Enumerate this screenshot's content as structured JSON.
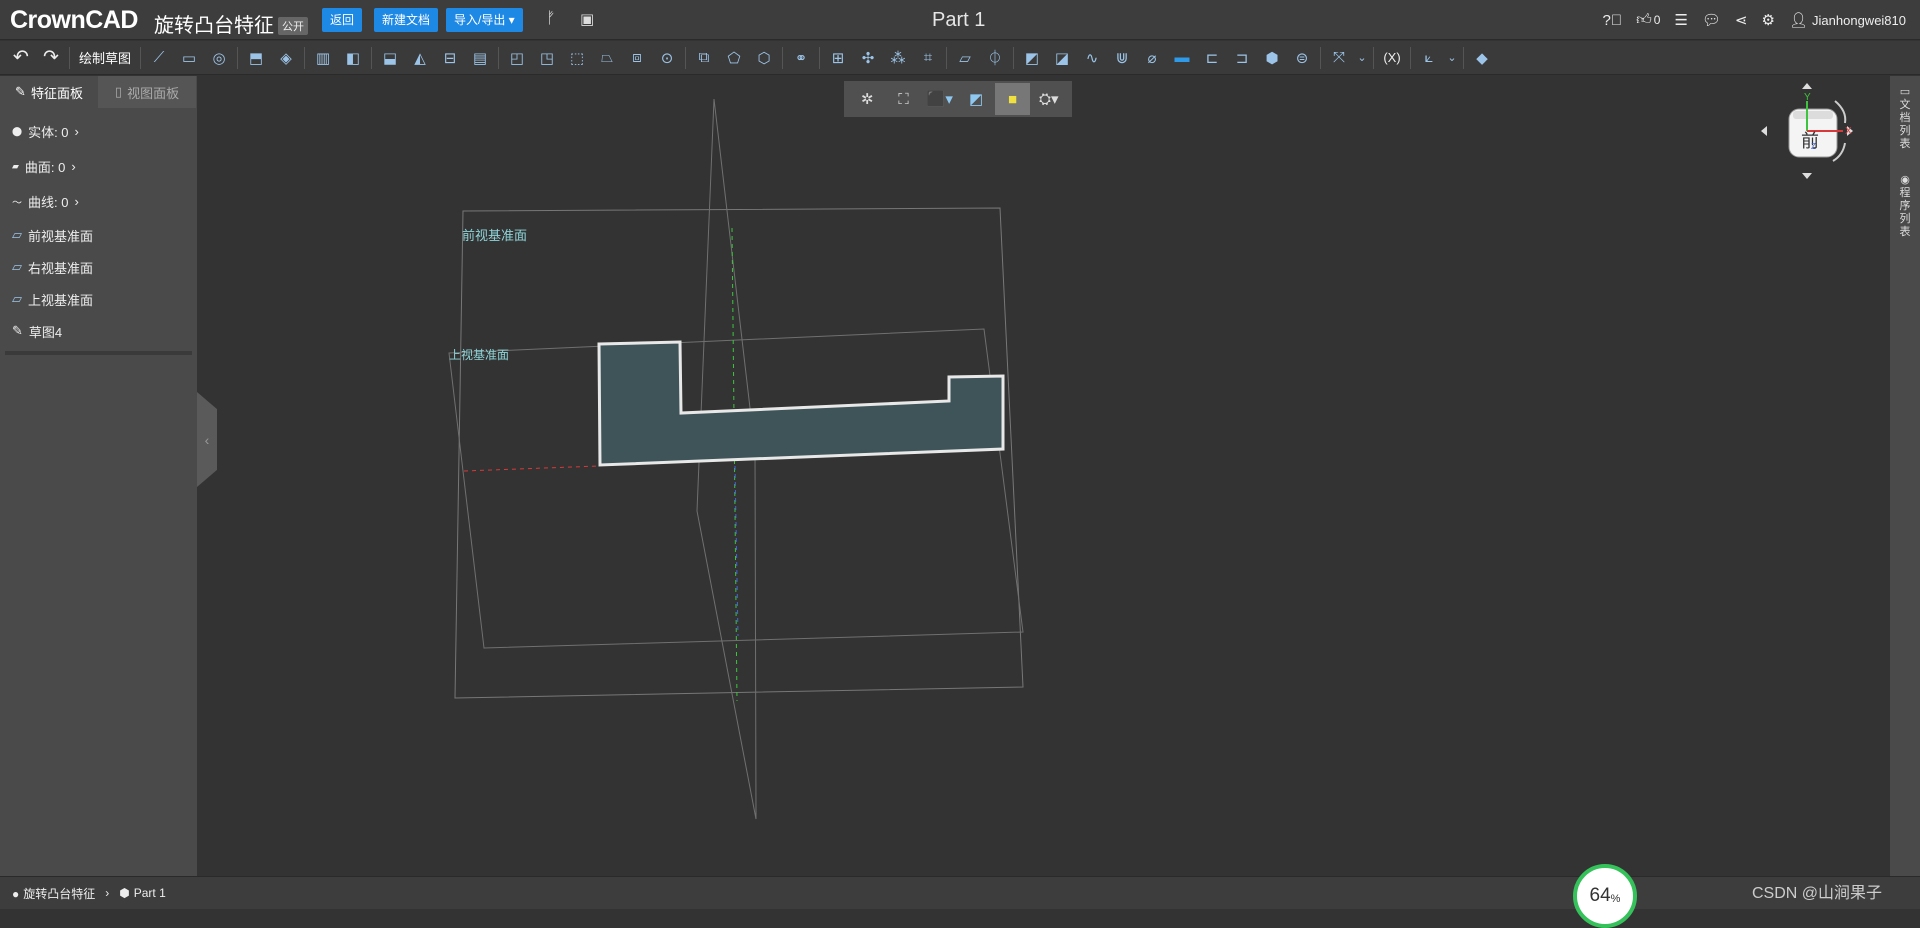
{
  "header": {
    "logo": "CrownCAD",
    "doc_title": "旋转凸台特征",
    "visibility": "公开",
    "back_label": "返回",
    "new_doc_label": "新建文档",
    "import_export_label": "导入/导出",
    "part_name": "Part 1",
    "like_count": "0",
    "username": "Jianhongwei810"
  },
  "toolbar": {
    "sketch_label": "绘制草图"
  },
  "sidebar": {
    "tab_features": "特征面板",
    "tab_views": "视图面板",
    "solids": "实体: 0",
    "surfaces": "曲面: 0",
    "curves": "曲线: 0",
    "items": [
      "前视基准面",
      "右视基准面",
      "上视基准面",
      "草图4"
    ]
  },
  "viewport": {
    "front_plane_label": "前视基准面",
    "top_plane_label": "上视基准面",
    "cube_face": "前",
    "axis_x": "X",
    "axis_y": "Y",
    "axis_z": "Z"
  },
  "right_strip": {
    "doc_list": "文档列表",
    "program_list": "程序列表"
  },
  "status": {
    "doc": "旋转凸台特征",
    "part": "Part 1"
  },
  "progress": {
    "value": "64",
    "unit": "%"
  },
  "watermark": "CSDN @山涧果子",
  "colors": {
    "accent": "#1e88e5",
    "progress": "#35c25a",
    "sketch_fill": "#3f5458"
  }
}
